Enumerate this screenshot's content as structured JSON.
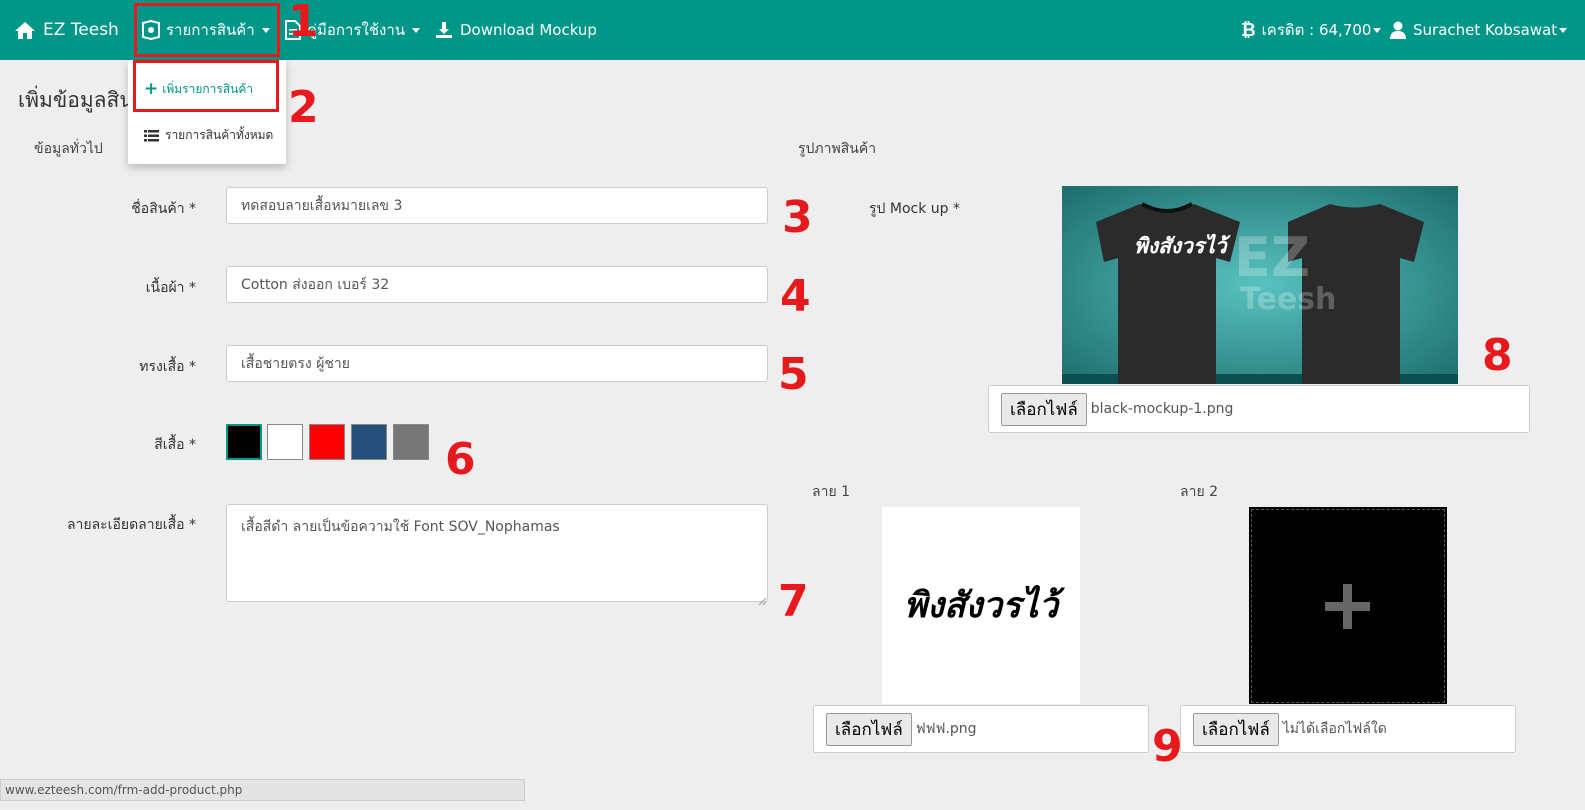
{
  "navbar": {
    "brand": "EZ Teesh",
    "products_menu": "รายการสินค้า",
    "manual_menu": "คู่มือการใช้งาน",
    "download": "Download Mockup",
    "credit": "เครดิต : 64,700",
    "user": "Surachet Kobsawat",
    "bg_color": "#009688"
  },
  "dropdown": {
    "add_product": "เพิ่มรายการสินค้า",
    "all_products": "รายการสินค้าทั้งหมด"
  },
  "page": {
    "title": "เพิ่มข้อมูลสินค้า",
    "general_section": "ข้อมูลทั่วไป",
    "image_section": "รูปภาพสินค้า"
  },
  "form": {
    "name_label": "ชื่อสินค้า *",
    "name_value": "ทดสอบลายเสื้อหมายเลข 3",
    "fabric_label": "เนื้อผ้า *",
    "fabric_value": "Cotton ส่งออก เบอร์ 32",
    "shape_label": "ทรงเสื้อ *",
    "shape_value": "เสื้อชายตรง ผู้ชาย",
    "color_label": "สีเสื้อ *",
    "colors": [
      "#000000",
      "#ffffff",
      "#ff0000",
      "#254e7a",
      "#777777"
    ],
    "detail_label": "ลายละเอียดลายเสื้อ *",
    "detail_value": "เสื้อสีดำ ลายเป็นข้อความใช้ Font SOV_Nophamas"
  },
  "images": {
    "mockup_label": "รูป Mock up *",
    "mockup_shirt_text": "พิงสังวรไว้",
    "mockup_watermark_1": "EZ",
    "mockup_watermark_2": "Teesh",
    "choose_file": "เลือกไฟล์",
    "mockup_file": "black-mockup-1.png",
    "design1_label": "ลาย 1",
    "design1_text": "พิงสังวรไว้",
    "design1_file": "ฟฟฟ.png",
    "design2_label": "ลาย 2",
    "design2_file": "ไม่ได้เลือกไฟล์ใด"
  },
  "annotations": [
    "1",
    "2",
    "3",
    "4",
    "5",
    "6",
    "7",
    "8",
    "9"
  ],
  "status_url": "www.ezteesh.com/frm-add-product.php"
}
